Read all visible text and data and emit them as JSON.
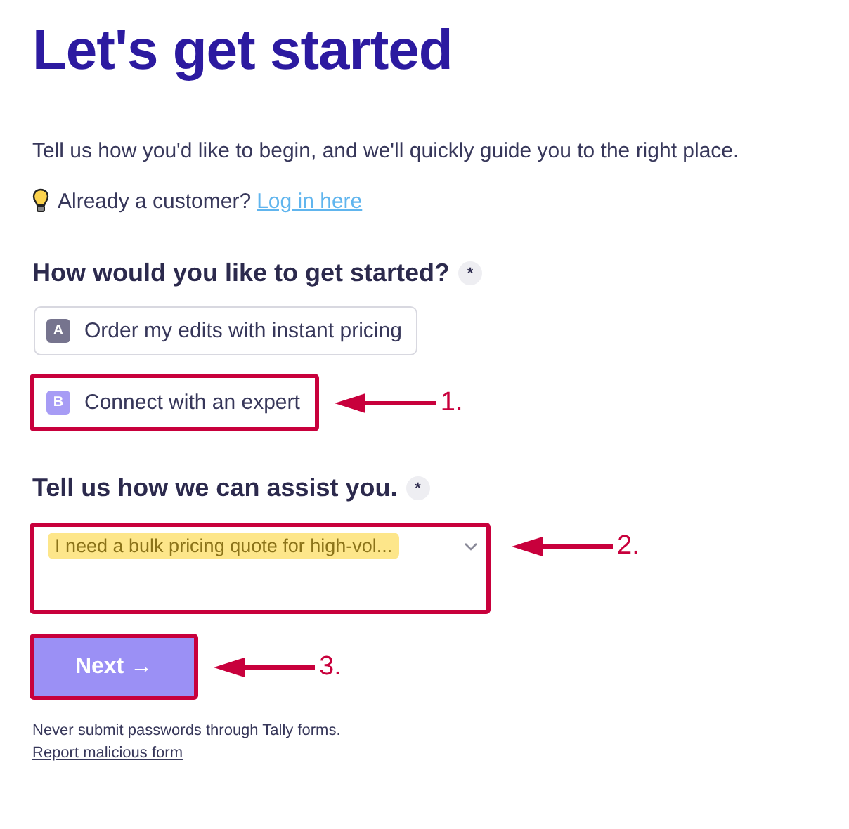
{
  "title": "Let's get started",
  "intro": "Tell us how you'd like to begin, and we'll quickly guide you to the right place.",
  "login": {
    "text": "Already a customer?",
    "link": "Log in here"
  },
  "question_1": {
    "label": "How would you like to get started?",
    "required": "*",
    "options": [
      {
        "key": "A",
        "label": "Order my edits with instant pricing",
        "selected": false
      },
      {
        "key": "B",
        "label": "Connect with an expert",
        "selected": true,
        "annotation": "1."
      }
    ]
  },
  "question_2": {
    "label": "Tell us how we can assist you.",
    "required": "*",
    "value": "I need a bulk pricing quote for high-vol...",
    "annotation": "2."
  },
  "next_button": {
    "label": "Next",
    "icon": "→",
    "annotation": "3."
  },
  "footer": {
    "note": "Never submit passwords through Tally forms.",
    "link": "Report malicious form"
  }
}
